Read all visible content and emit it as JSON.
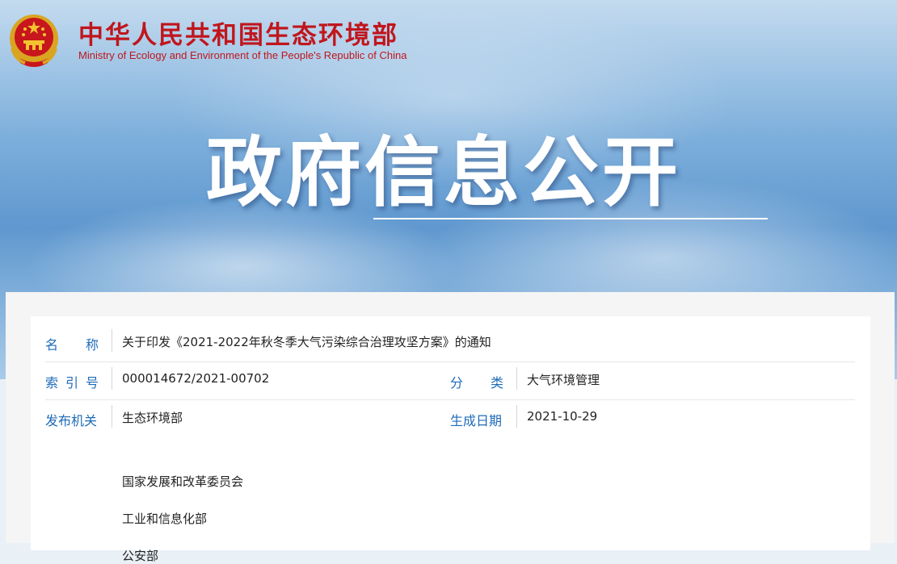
{
  "header": {
    "title": "中华人民共和国生态环境部",
    "subtitle": "Ministry of Ecology and Environment of the People's Republic of China",
    "emblem_icon": "national-emblem-icon"
  },
  "banner": {
    "heading": "政府信息公开"
  },
  "info": {
    "name_label_chars": [
      "名",
      "称"
    ],
    "name_value": "关于印发《2021-2022年秋冬季大气污染综合治理攻坚方案》的通知",
    "index_label_chars": [
      "索",
      "引",
      "号"
    ],
    "index_value": "000014672/2021-00702",
    "category_label_chars": [
      "分",
      "类"
    ],
    "category_value": "大气环境管理",
    "issuer_label": "发布机关",
    "issuers": [
      "生态环境部",
      "国家发展和改革委员会",
      "工业和信息化部",
      "公安部"
    ],
    "date_label": "生成日期",
    "date_value": "2021-10-29"
  },
  "colors": {
    "brand_red": "#c0161d",
    "label_blue": "#1e6bb8"
  }
}
